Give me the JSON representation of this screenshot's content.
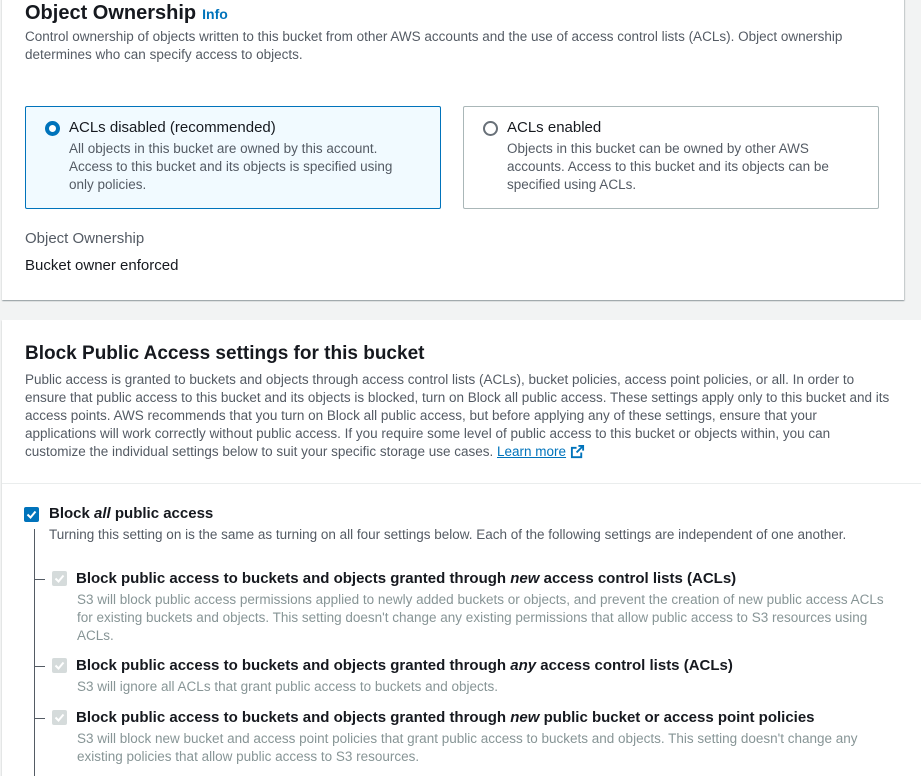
{
  "ownership": {
    "title": "Object Ownership",
    "info": "Info",
    "description": "Control ownership of objects written to this bucket from other AWS accounts and the use of access control lists (ACLs). Object ownership determines who can specify access to objects.",
    "options": [
      {
        "label": "ACLs disabled (recommended)",
        "description": "All objects in this bucket are owned by this account. Access to this bucket and its objects is specified using only policies.",
        "selected": true
      },
      {
        "label": "ACLs enabled",
        "description": "Objects in this bucket can be owned by other AWS accounts. Access to this bucket and its objects can be specified using ACLs.",
        "selected": false
      }
    ],
    "field_label": "Object Ownership",
    "field_value": "Bucket owner enforced"
  },
  "block_public": {
    "title": "Block Public Access settings for this bucket",
    "description": "Public access is granted to buckets and objects through access control lists (ACLs), bucket policies, access point policies, or all. In order to ensure that public access to this bucket and its objects is blocked, turn on Block all public access. These settings apply only to this bucket and its access points. AWS recommends that you turn on Block all public access, but before applying any of these settings, ensure that your applications will work correctly without public access. If you require some level of public access to this bucket or objects within, you can customize the individual settings below to suit your specific storage use cases.",
    "learn_more": "Learn more",
    "main": {
      "label_prefix": "Block ",
      "label_em": "all",
      "label_suffix": " public access",
      "checked": true,
      "description": "Turning this setting on is the same as turning on all four settings below. Each of the following settings are independent of one another."
    },
    "sub": [
      {
        "label_prefix": "Block public access to buckets and objects granted through ",
        "label_em": "new",
        "label_suffix": " access control lists (ACLs)",
        "description": "S3 will block public access permissions applied to newly added buckets or objects, and prevent the creation of new public access ACLs for existing buckets and objects. This setting doesn't change any existing permissions that allow public access to S3 resources using ACLs.",
        "checked": true
      },
      {
        "label_prefix": "Block public access to buckets and objects granted through ",
        "label_em": "any",
        "label_suffix": " access control lists (ACLs)",
        "description": "S3 will ignore all ACLs that grant public access to buckets and objects.",
        "checked": true
      },
      {
        "label_prefix": "Block public access to buckets and objects granted through ",
        "label_em": "new",
        "label_suffix": " public bucket or access point policies",
        "description": "S3 will block new bucket and access point policies that grant public access to buckets and objects. This setting doesn't change any existing policies that allow public access to S3 resources.",
        "checked": true
      }
    ]
  }
}
